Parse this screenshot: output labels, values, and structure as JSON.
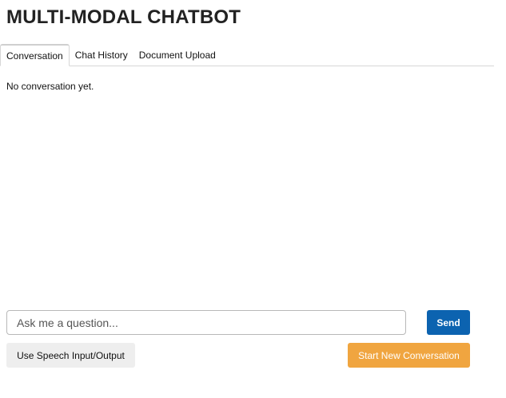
{
  "app": {
    "title": "MULTI-MODAL CHATBOT"
  },
  "tabs": [
    {
      "label": "Conversation",
      "active": true
    },
    {
      "label": "Chat History",
      "active": false
    },
    {
      "label": "Document Upload",
      "active": false
    }
  ],
  "conversation": {
    "empty_message": "No conversation yet."
  },
  "input": {
    "placeholder": "Ask me a question...",
    "value": ""
  },
  "buttons": {
    "send": "Send",
    "speech": "Use Speech Input/Output",
    "new_conversation": "Start New Conversation"
  },
  "colors": {
    "send_button": "#0c63b0",
    "new_conversation_button": "#f0a540",
    "speech_button": "#eeeeee"
  }
}
